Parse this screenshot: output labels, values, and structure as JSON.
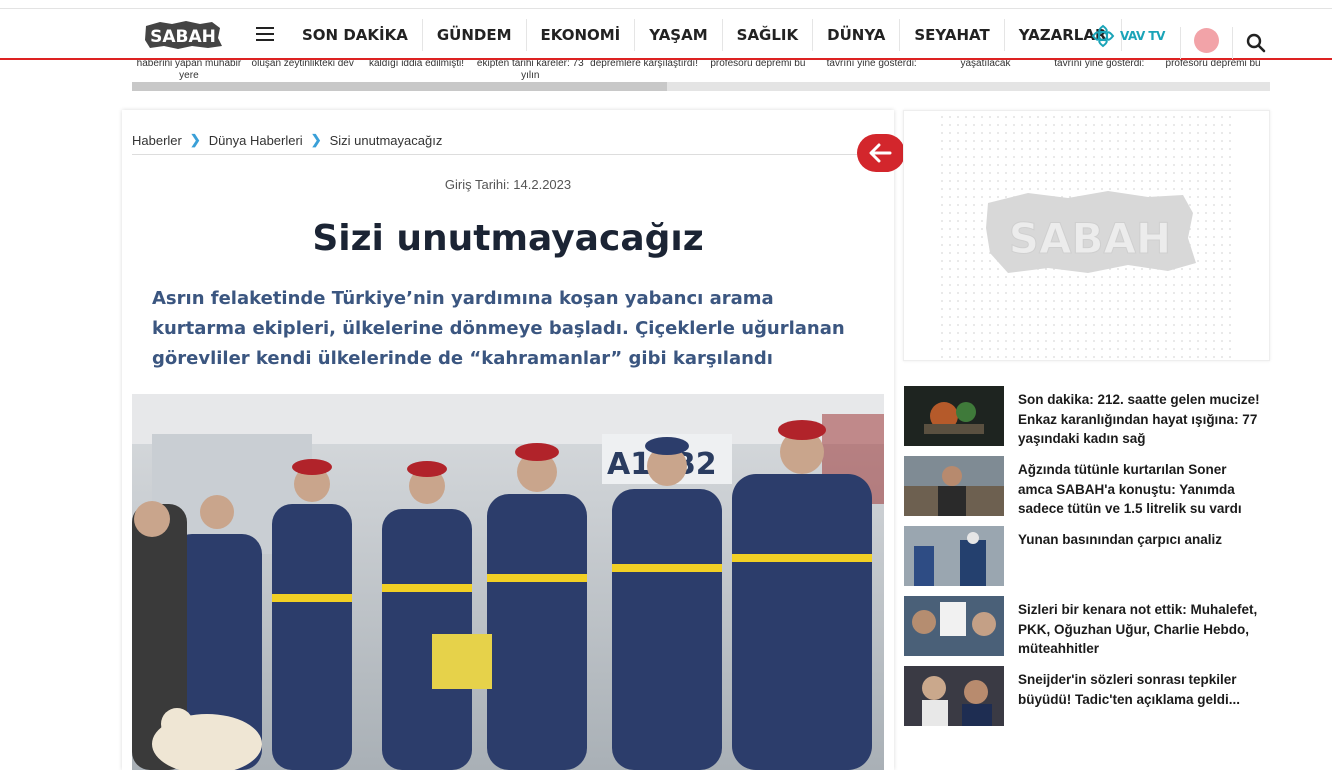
{
  "header": {
    "logo_text": "SABAH",
    "nav": [
      "SON DAKİKA",
      "GÜNDEM",
      "EKONOMİ",
      "YAŞAM",
      "SAĞLIK",
      "DÜNYA",
      "SEYAHAT",
      "YAZARLAR"
    ],
    "vavtv_label": "VAV TV",
    "accent_color": "#d22222"
  },
  "ticker": {
    "items": [
      "haberini yapan muhabir yere",
      "oluşan zeytinlikteki dev",
      "kaldığı iddia edilmişti!",
      "ekipten tarihi kareler: 73 yılın",
      "depremlere karşılaştırdı!",
      "profesörü depremi bu",
      "tavrını yine gösterdi:",
      "yaşatılacak",
      "tavrını yine gösterdi:",
      "profesörü depremi bu"
    ],
    "progress": 0.47
  },
  "article": {
    "breadcrumb": [
      "Haberler",
      "Dünya Haberleri",
      "Sizi unutmayacağız"
    ],
    "date": "Giriş Tarihi: 14.2.2023",
    "title": "Sizi unutmayacağız",
    "spot": "Asrın felaketinde Türkiye’nin yardımına koşan yabancı arama kurtarma ekipleri, ülkelerine dönmeye başladı. Çiçeklerle uğurlanan görevliler kendi ülkelerinde de “kahramanlar” gibi karşılandı",
    "photo_sign": "A1, B2"
  },
  "ad": {
    "logo_text": "SABAH"
  },
  "sidebar": {
    "items": [
      "Son dakika: 212. saatte gelen mucize! Enkaz karanlığından hayat ışığına: 77 yaşındaki kadın sağ",
      "Ağzında tütünle kurtarılan Soner amca SABAH'a konuştu: Yanımda sadece tütün ve 1.5 litrelik su vardı",
      "Yunan basınından çarpıcı analiz",
      "Sizleri bir kenara not ettik: Muhalefet, PKK, Oğuzhan Uğur, Charlie Hebdo, müteahhitler",
      "Sneijder'in sözleri sonrası tepkiler büyüdü! Tadic'ten açıklama geldi..."
    ]
  }
}
